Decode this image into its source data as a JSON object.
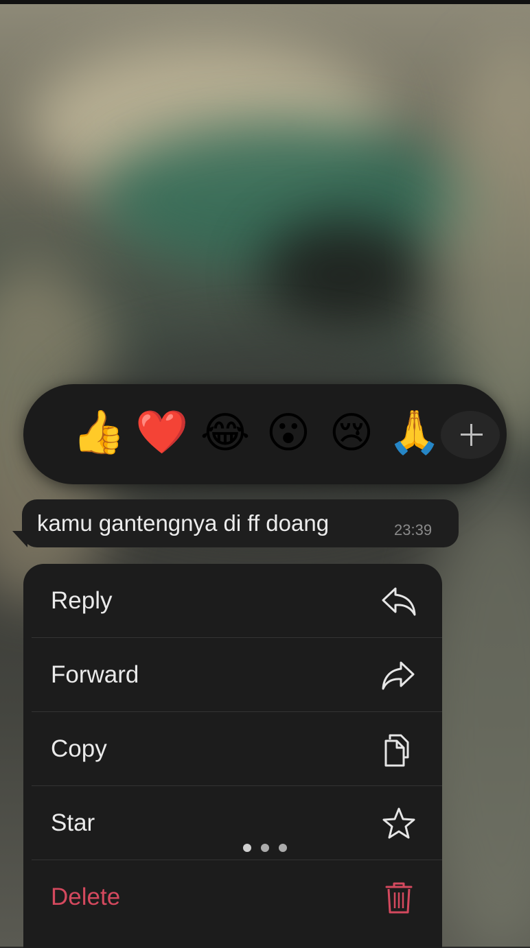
{
  "reactions": {
    "emojis": [
      {
        "name": "thumbs-up",
        "glyph": "👍"
      },
      {
        "name": "red-heart",
        "glyph": "❤️"
      },
      {
        "name": "tears-of-joy",
        "glyph": "😂"
      },
      {
        "name": "surprised",
        "glyph": "😮"
      },
      {
        "name": "crying",
        "glyph": "😢"
      },
      {
        "name": "folded-hands",
        "glyph": "🙏"
      }
    ],
    "more_icon": "plus-icon"
  },
  "message": {
    "text": "kamu gantengnya di ff doang",
    "time": "23:39"
  },
  "menu": {
    "items": [
      {
        "label": "Reply",
        "icon": "reply-icon"
      },
      {
        "label": "Forward",
        "icon": "forward-icon"
      },
      {
        "label": "Copy",
        "icon": "copy-icon"
      },
      {
        "label": "Star",
        "icon": "star-icon"
      },
      {
        "label": "Delete",
        "icon": "trash-icon"
      }
    ]
  },
  "colors": {
    "menu_bg": "#1c1c1c",
    "bubble_bg": "#1e1e1e",
    "text": "#eaeaea",
    "destructive": "#d4495e",
    "timestamp": "#8a8a8a"
  }
}
